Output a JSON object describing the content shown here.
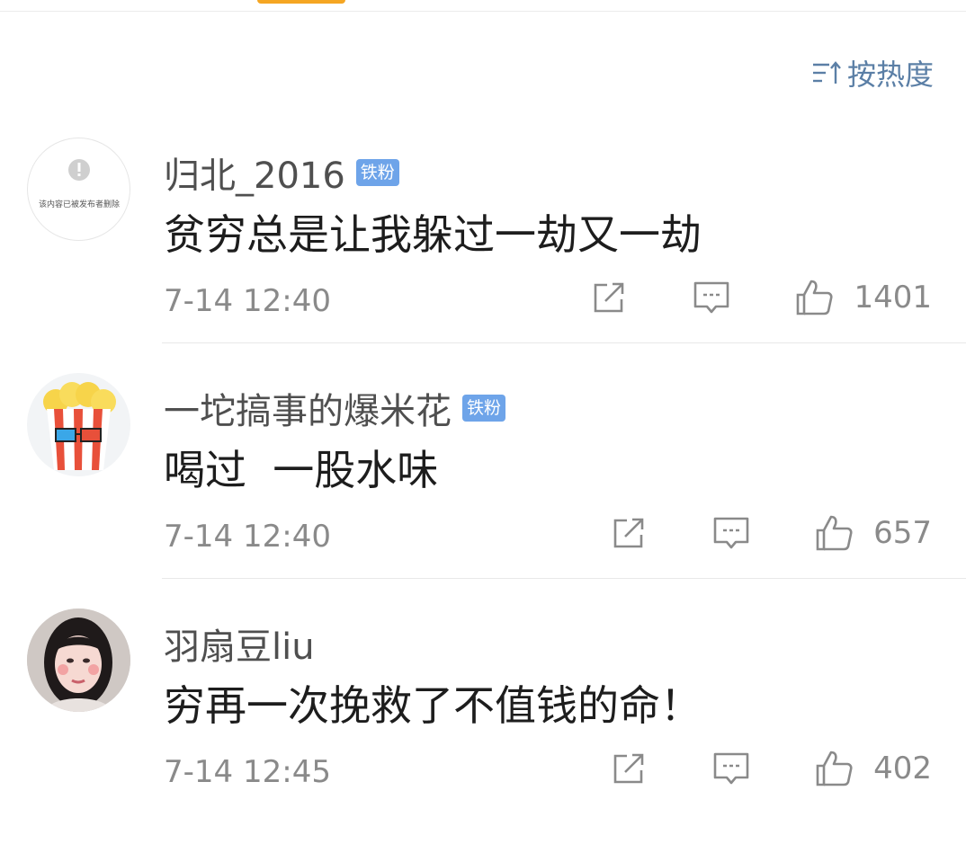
{
  "sort": {
    "label": "按热度",
    "icon": "sort-hot-icon"
  },
  "comments": [
    {
      "username": "归北_2016",
      "badge": "铁粉",
      "avatar_text": "该内容已被发布者删除",
      "text": "贫穷总是让我躲过一劫又一劫",
      "time": "7-14 12:40",
      "likes": "1401"
    },
    {
      "username": "一坨搞事的爆米花",
      "badge": "铁粉",
      "text": "喝过  一股水味",
      "time": "7-14 12:40",
      "likes": "657"
    },
    {
      "username": "羽扇豆liu",
      "text": "穷再一次挽救了不值钱的命！",
      "time": "7-14 12:45",
      "likes": "402"
    }
  ],
  "colors": {
    "accent": "#f5a623",
    "link": "#5b7fa6",
    "badge": "#6ea4e9"
  }
}
